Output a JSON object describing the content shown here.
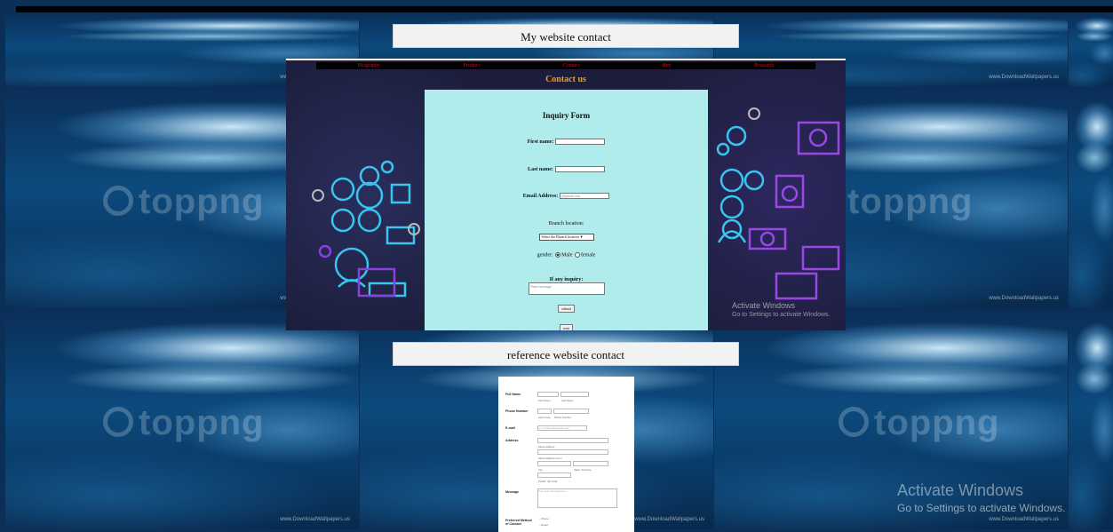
{
  "sections": {
    "my_site_label": "My website contact",
    "reference_label": "reference website contact"
  },
  "background": {
    "watermark": "toppng",
    "credit": "www.DownloadWallpapers.us"
  },
  "nav": {
    "items": [
      "Biography",
      "Product",
      "Contact",
      "Buy",
      "Research"
    ]
  },
  "page_title": "Contact us",
  "form": {
    "title": "Inquiry Form",
    "first_name_label": "First name:",
    "last_name_label": "Last name:",
    "email_label": "Email Address:",
    "email_placeholder": "@gmail.com",
    "branch_label": "Branch location:",
    "branch_selected": "Select the Branch location",
    "gender_label": "gender:",
    "gender_male": "Male",
    "gender_female": "female",
    "inquiry_label": "If any inquiry:",
    "inquiry_placeholder": "Enter message",
    "submit_label": "submit",
    "reset_label": "reset"
  },
  "reference_form": {
    "full_name_label": "Full Name",
    "first_name_sub": "First Name",
    "last_name_sub": "Last Name",
    "phone_label": "Phone Number",
    "area_code_sub": "Area Code",
    "phone_sub": "Phone Number",
    "email_label": "E-mail",
    "email_placeholder": "ex: myname@example.com",
    "address_label": "Address",
    "street_sub": "Street Address",
    "street2_sub": "Street Address Line 2",
    "city_sub": "City",
    "state_sub": "State / Province",
    "postal_sub": "Postal / Zip Code",
    "message_label": "Message",
    "message_placeholder": "Type your message here...",
    "preferred_label": "Preferred Method of Contact",
    "opt_phone": "Phone",
    "opt_email": "Email"
  },
  "overlay": {
    "activate_title": "Activate Windows",
    "activate_sub": "Go to Settings to activate Windows.",
    "activate_title_2": "Activate Windows",
    "activate_sub_2": "Go to Settings to activate Windows."
  }
}
